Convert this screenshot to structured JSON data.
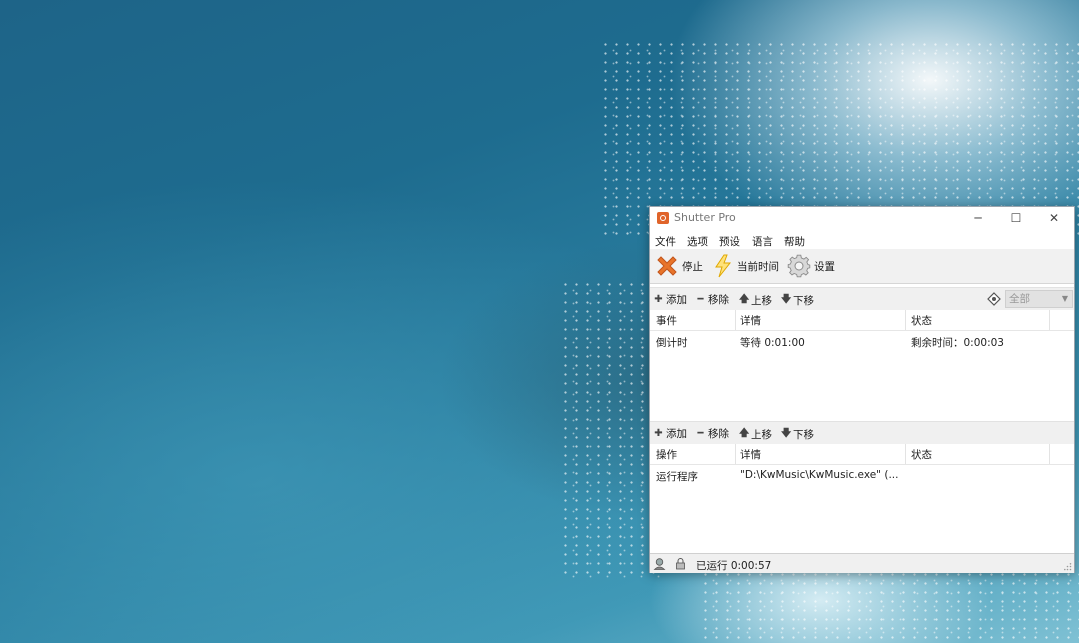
{
  "window": {
    "title": "Shutter Pro",
    "controls": {
      "minimize": "─",
      "maximize": "☐",
      "close": "✕"
    }
  },
  "menu": [
    "文件",
    "选项",
    "预设",
    "语言",
    "帮助"
  ],
  "toolbar": {
    "stop_label": "停止",
    "current_time_label": "当前时间",
    "settings_label": "设置"
  },
  "events_toolbar": {
    "add": "添加",
    "remove": "移除",
    "move_up": "上移",
    "move_down": "下移",
    "filter_value": "全部"
  },
  "events_table": {
    "headers": [
      "事件",
      "详情",
      "状态"
    ],
    "rows": [
      {
        "event": "倒计时",
        "detail": "等待 0:01:00",
        "status": "剩余时间：0:00:03"
      }
    ]
  },
  "actions_toolbar": {
    "add": "添加",
    "remove": "移除",
    "move_up": "上移",
    "move_down": "下移"
  },
  "actions_table": {
    "headers": [
      "操作",
      "详情",
      "状态"
    ],
    "rows": [
      {
        "action": "运行程序",
        "detail": "\"D:\\KwMusic\\KwMusic.exe\" (...",
        "status": ""
      }
    ]
  },
  "status_bar": {
    "running": "已运行 0:00:57"
  },
  "icons": {
    "app": "shutter-app-icon",
    "stop": "red-x-icon",
    "current_time": "lightning-icon",
    "settings": "gear-icon",
    "add": "plus-icon",
    "remove": "minus-icon",
    "up": "up-arrow-icon",
    "down": "down-arrow-icon",
    "filter": "diamond-icon"
  },
  "colors": {
    "stop_red": "#e8742a",
    "lightning": "#f5c518",
    "window_bg": "#ffffff"
  }
}
